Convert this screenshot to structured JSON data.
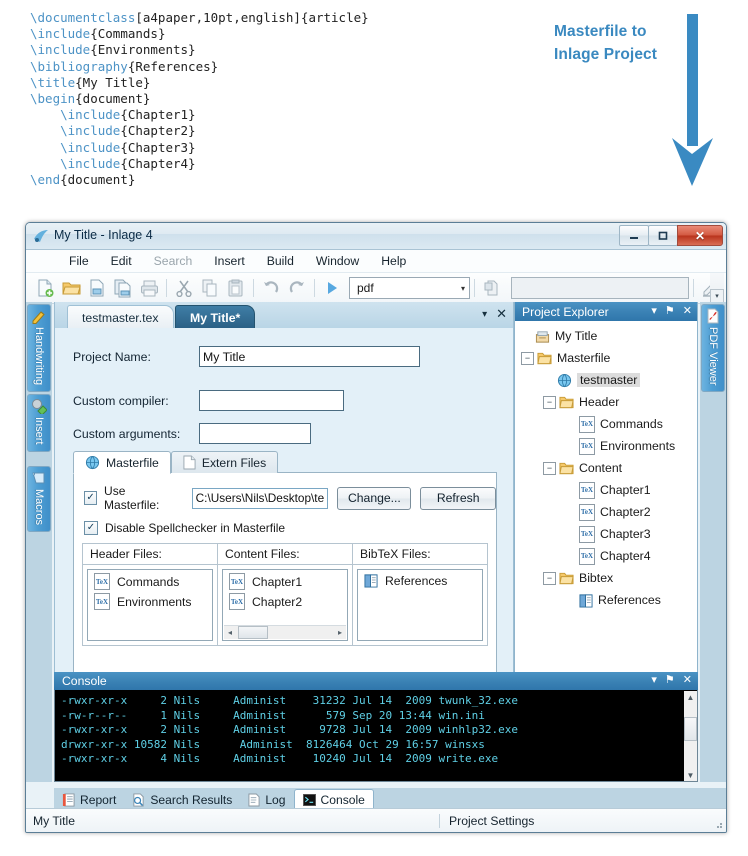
{
  "annotation": {
    "line1": "Masterfile to",
    "line2": "Inlage Project",
    "color": "#3a89c0"
  },
  "latex": {
    "lines": [
      "\\documentclass[a4paper,10pt,english]{article}",
      "\\include{Commands}",
      "\\include{Environments}",
      "\\bibliography{References}",
      "\\title{My Title}",
      "\\begin{document}",
      "    \\include{Chapter1}",
      "    \\include{Chapter2}",
      "    \\include{Chapter3}",
      "    \\include{Chapter4}",
      "\\end{document}"
    ]
  },
  "window": {
    "title": "My Title - Inlage 4",
    "minimize_label": "–",
    "maximize_label": "□",
    "close_label": "✕"
  },
  "menu": {
    "items": [
      {
        "label": "File",
        "disabled": false
      },
      {
        "label": "Edit",
        "disabled": false
      },
      {
        "label": "Search",
        "disabled": true
      },
      {
        "label": "Insert",
        "disabled": false
      },
      {
        "label": "Build",
        "disabled": false
      },
      {
        "label": "Window",
        "disabled": false
      },
      {
        "label": "Help",
        "disabled": false
      }
    ]
  },
  "toolbar": {
    "icons": [
      "new-file-icon",
      "open-folder-icon",
      "save-icon",
      "save-all-icon",
      "print-icon",
      "cut-icon",
      "copy-icon",
      "paste-icon",
      "undo-icon",
      "redo-icon",
      "build-run-icon"
    ],
    "format_select": "pdf",
    "format_arrow": "▾",
    "search_field_value": "",
    "overflow_label": "▾"
  },
  "left_strip": {
    "tabs": [
      {
        "label": "Handwriting",
        "icon": "pencil-icon"
      },
      {
        "label": "Insert",
        "icon": "insert-icon"
      },
      {
        "label": "Macros",
        "icon": "macros-icon"
      }
    ]
  },
  "right_strip": {
    "tabs": [
      {
        "label": "PDF Viewer",
        "icon": "pdf-icon"
      }
    ]
  },
  "editor": {
    "tabs": [
      {
        "label": "testmaster.tex",
        "active": false
      },
      {
        "label": "My Title*",
        "active": true
      }
    ],
    "dropdown_label": "▾",
    "close_label": "✕"
  },
  "project_form": {
    "project_name_label": "Project Name:",
    "project_name_value": "My Title",
    "custom_compiler_label": "Custom compiler:",
    "custom_compiler_value": "",
    "custom_arguments_label": "Custom arguments:",
    "custom_arguments_value": ""
  },
  "inner_tabs": [
    {
      "label": "Masterfile",
      "icon": "masterfile-icon",
      "active": true
    },
    {
      "label": "Extern Files",
      "icon": "file-icon",
      "active": false
    }
  ],
  "masterfile_panel": {
    "use_masterfile_label": "Use Masterfile:",
    "use_masterfile_checked": true,
    "check_glyph": "✓",
    "path_value": "C:\\Users\\Nils\\Desktop\\te",
    "change_button": "Change...",
    "refresh_button": "Refresh",
    "disable_spellchecker_label": "Disable Spellchecker in Masterfile",
    "disable_spellchecker_checked": true,
    "columns": [
      {
        "header": "Header Files:",
        "items": [
          {
            "label": "Commands",
            "icon": "tex-icon"
          },
          {
            "label": "Environments",
            "icon": "tex-icon"
          }
        ],
        "scrollbar": false
      },
      {
        "header": "Content Files:",
        "items": [
          {
            "label": "Chapter1",
            "icon": "tex-icon"
          },
          {
            "label": "Chapter2",
            "icon": "tex-icon"
          }
        ],
        "scrollbar": true,
        "scroll_left": "◂",
        "scroll_right": "▸"
      },
      {
        "header": "BibTeX Files:",
        "items": [
          {
            "label": "References",
            "icon": "bibtex-icon"
          }
        ],
        "scrollbar": false
      }
    ]
  },
  "explorer": {
    "title": "Project Explorer",
    "dropdown_label": "▾",
    "pin_label": "⚑",
    "close_label": "✕",
    "nodes": [
      {
        "label": "My Title",
        "depth": 0,
        "icon": "project-icon",
        "expander": "",
        "selected": false
      },
      {
        "label": "Masterfile",
        "depth": 0,
        "icon": "folder-icon",
        "expander": "-",
        "selected": false
      },
      {
        "label": "testmaster",
        "depth": 1,
        "icon": "masterfile-icon",
        "expander": "",
        "selected": true
      },
      {
        "label": "Header",
        "depth": 1,
        "icon": "folder-icon",
        "expander": "-",
        "selected": false
      },
      {
        "label": "Commands",
        "depth": 2,
        "icon": "tex-icon",
        "expander": "",
        "selected": false
      },
      {
        "label": "Environments",
        "depth": 2,
        "icon": "tex-icon",
        "expander": "",
        "selected": false
      },
      {
        "label": "Content",
        "depth": 1,
        "icon": "folder-icon",
        "expander": "-",
        "selected": false
      },
      {
        "label": "Chapter1",
        "depth": 2,
        "icon": "tex-icon",
        "expander": "",
        "selected": false
      },
      {
        "label": "Chapter2",
        "depth": 2,
        "icon": "tex-icon",
        "expander": "",
        "selected": false
      },
      {
        "label": "Chapter3",
        "depth": 2,
        "icon": "tex-icon",
        "expander": "",
        "selected": false
      },
      {
        "label": "Chapter4",
        "depth": 2,
        "icon": "tex-icon",
        "expander": "",
        "selected": false
      },
      {
        "label": "Bibtex",
        "depth": 1,
        "icon": "folder-icon",
        "expander": "-",
        "selected": false
      },
      {
        "label": "References",
        "depth": 2,
        "icon": "bibtex-icon",
        "expander": "",
        "selected": false
      }
    ]
  },
  "console": {
    "title": "Console",
    "dropdown_label": "▾",
    "pin_label": "⚑",
    "close_label": "✕",
    "scroll_up": "▲",
    "scroll_down": "▼",
    "lines": [
      "-rwxr-xr-x     2 Nils     Administ    31232 Jul 14  2009 twunk_32.exe",
      "-rw-r--r--     1 Nils     Administ      579 Sep 20 13:44 win.ini",
      "-rwxr-xr-x     2 Nils     Administ     9728 Jul 14  2009 winhlp32.exe",
      "drwxr-xr-x 10582 Nils      Administ  8126464 Oct 29 16:57 winsxs",
      "-rwxr-xr-x     4 Nils     Administ    10240 Jul 14  2009 write.exe"
    ]
  },
  "bottom_tabs": [
    {
      "label": "Report",
      "icon": "report-icon",
      "active": false
    },
    {
      "label": "Search Results",
      "icon": "search-icon",
      "active": false
    },
    {
      "label": "Log",
      "icon": "log-icon",
      "active": false
    },
    {
      "label": "Console",
      "icon": "console-icon",
      "active": true
    }
  ],
  "statusbar": {
    "left": "My Title",
    "right": "Project Settings"
  }
}
